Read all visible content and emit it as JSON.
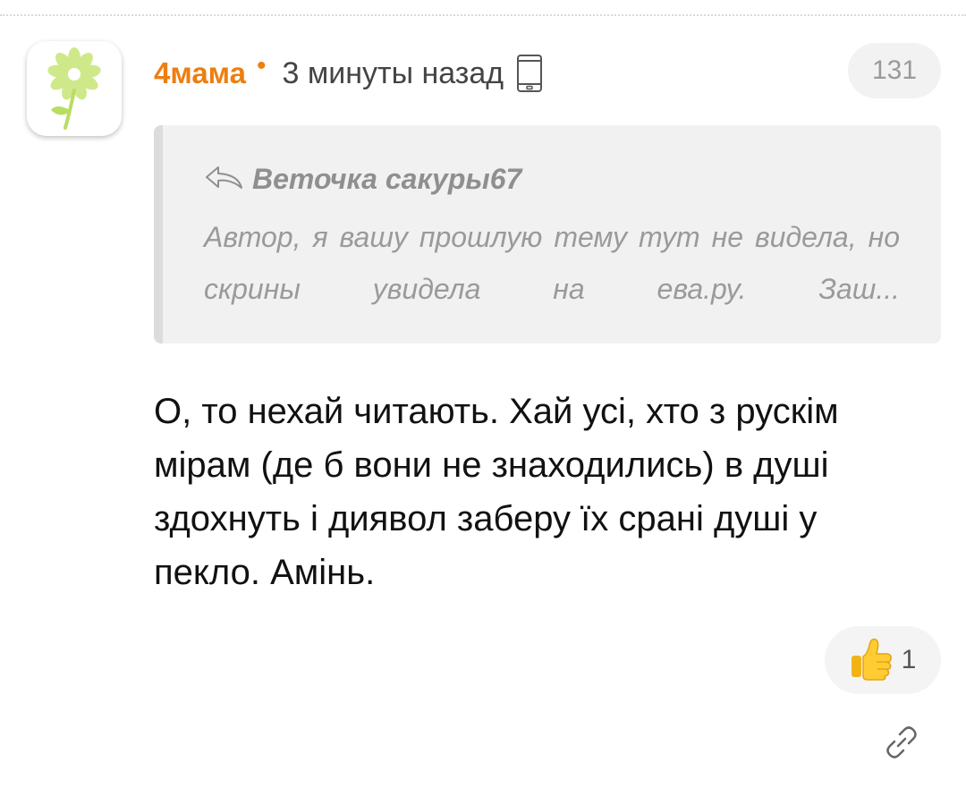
{
  "comment": {
    "author": "4мама",
    "separator": "•",
    "time": "3 минуты назад",
    "device_icon": "mobile-phone-icon",
    "number": "131",
    "quote": {
      "icon": "reply-arrow-icon",
      "author": "Веточка сакуры67",
      "text": "Автор, я вашу прошлую тему тут не видела, но скрины увидела на ева.ру. Заш..."
    },
    "text": "О, то нехай читають. Хай усі, хто з рускім мірам (де б вони не знаходились) в душі здохнуть і диявол заберу їх срані душі у пекло. Амінь.",
    "like": {
      "icon": "thumbs-up-icon",
      "count": "1"
    },
    "link_icon": "link-icon"
  },
  "colors": {
    "author": "#ee7e10",
    "quote_background": "#f1f1f1",
    "avatar_flower": "#c8e87a"
  },
  "avatar": {
    "icon": "flower-avatar-icon"
  }
}
